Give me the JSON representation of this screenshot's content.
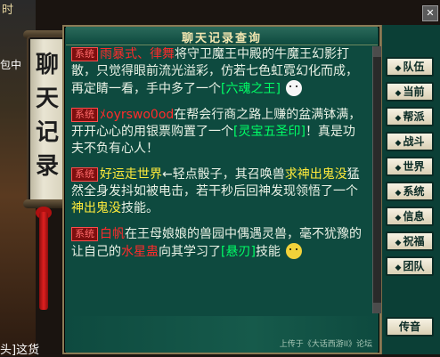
{
  "window": {
    "title": "聊天记录查询"
  },
  "scroll_title_chars": [
    "聊",
    "天",
    "记",
    "录"
  ],
  "left_bg": {
    "corner": "时",
    "pack": "包中",
    "bottom": "头]这货"
  },
  "buttons": [
    "队伍",
    "当前",
    "帮派",
    "战斗",
    "世界",
    "系统",
    "信息",
    "祝福",
    "团队"
  ],
  "bottom_buttons": [
    "传音"
  ],
  "watermark": "上传于《大话西游II》论坛",
  "messages": [
    {
      "badge": "系统",
      "parts": [
        {
          "text": "雨暴式、律舞",
          "cls": "red"
        },
        {
          "text": "将守卫魔王中殿的牛魔王幻影打散，只觉得眼前流光溢彩，仿若七色虹霓幻化而成，再定睛一看，手中多了一个",
          "cls": ""
        },
        {
          "text": "[六魂之王]",
          "cls": "green"
        }
      ]
    },
    {
      "badge": "系统",
      "parts": [
        {
          "text": "ﾒoyrswo0od",
          "cls": "red"
        },
        {
          "text": "在帮会行商之路上赚的盆满钵满，开开心心的用银票购置了一个",
          "cls": ""
        },
        {
          "text": "[灵宝五圣印]",
          "cls": "green"
        },
        {
          "text": "！真是功夫不负有心人！",
          "cls": ""
        }
      ]
    },
    {
      "badge": "系统",
      "parts": [
        {
          "text": "好运走世界",
          "cls": "yellow"
        },
        {
          "text": "←轻点骰子，其召唤兽",
          "cls": ""
        },
        {
          "text": "求神出鬼没",
          "cls": "yellow"
        },
        {
          "text": "猛然全身发抖如被电击，若干秒后回神发现领悟了一个",
          "cls": ""
        },
        {
          "text": "神出鬼没",
          "cls": "yellow"
        },
        {
          "text": "技能。",
          "cls": ""
        }
      ]
    },
    {
      "badge": "系统",
      "parts": [
        {
          "text": "白帆",
          "cls": "red"
        },
        {
          "text": "在王母娘娘的兽园中偶遇灵兽，毫不犹豫的让自己的",
          "cls": ""
        },
        {
          "text": "水星蛊",
          "cls": "red"
        },
        {
          "text": "向其学习了",
          "cls": ""
        },
        {
          "text": "[悬刃]",
          "cls": "green"
        },
        {
          "text": "技能",
          "cls": ""
        }
      ]
    }
  ]
}
